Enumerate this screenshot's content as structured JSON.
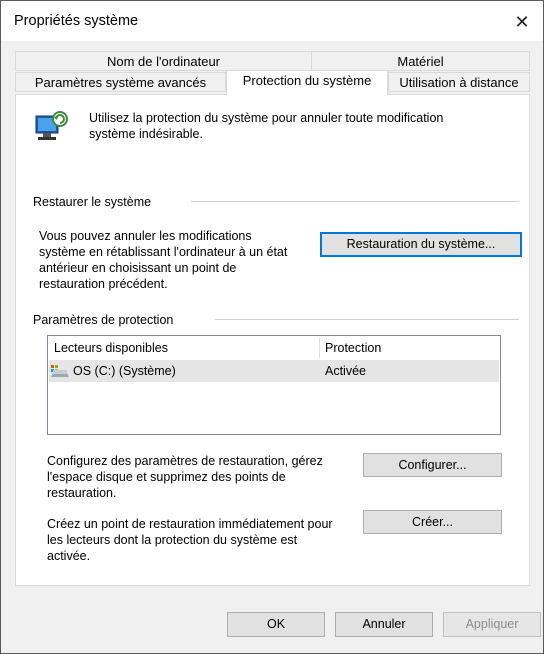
{
  "window": {
    "title": "Propriétés système",
    "close_glyph": "✕"
  },
  "tabs_row1": [
    {
      "label": "Nom de l'ordinateur"
    },
    {
      "label": "Matériel"
    }
  ],
  "tabs_row2": [
    {
      "label": "Paramètres système avancés"
    },
    {
      "label": "Protection du système",
      "active": true
    },
    {
      "label": "Utilisation à distance"
    }
  ],
  "intro": {
    "text_line1": "Utilisez la protection du système pour annuler toute modification",
    "text_line2": "système indésirable.",
    "icon": "system-protection-icon"
  },
  "restore": {
    "heading": "Restaurer le système",
    "desc_lines": [
      "Vous pouvez annuler les modifications",
      "système en rétablissant l'ordinateur à un état",
      "antérieur en choisissant un point de",
      "restauration précédent."
    ],
    "button": "Restauration du système..."
  },
  "protection": {
    "heading": "Paramètres de protection",
    "columns": [
      "Lecteurs disponibles",
      "Protection"
    ],
    "rows": [
      {
        "drive": "OS (C:) (Système)",
        "status": "Activée",
        "icon": "drive-icon"
      }
    ],
    "configure_lines": [
      "Configurez des paramètres de restauration, gérez",
      "l'espace disque et supprimez des points de",
      "restauration."
    ],
    "configure_button": "Configurer...",
    "create_lines": [
      "Créez un point de restauration immédiatement pour",
      "les lecteurs dont la protection du système est",
      "activée."
    ],
    "create_button": "Créer..."
  },
  "footer": {
    "ok": "OK",
    "cancel": "Annuler",
    "apply": "Appliquer"
  },
  "colors": {
    "accent": "#0078d7",
    "selected_row": "#e5e5e5",
    "dialog_bg": "#f0f0f0"
  }
}
